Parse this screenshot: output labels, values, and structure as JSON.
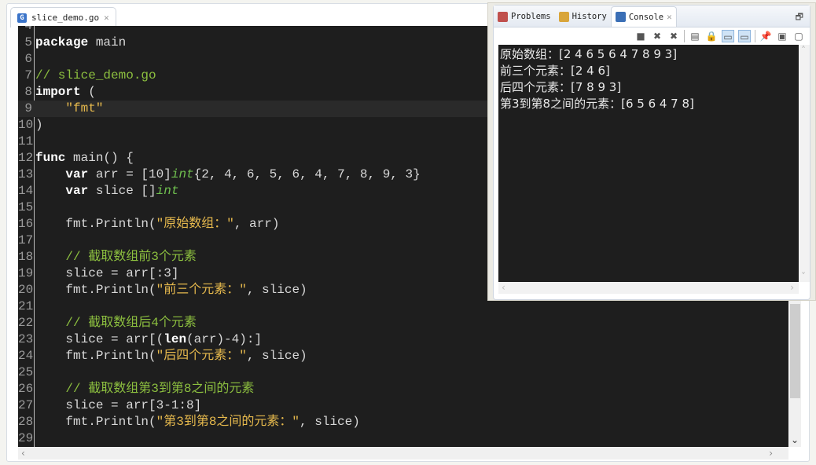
{
  "editor": {
    "tab_label": "slice_demo.go",
    "highlight_line": 9,
    "first_line": 4,
    "lines": [
      {
        "n": "4",
        "tokens": []
      },
      {
        "n": "5",
        "tokens": [
          {
            "t": "package",
            "c": "kw"
          },
          {
            "t": " main",
            "c": ""
          }
        ]
      },
      {
        "n": "6",
        "tokens": []
      },
      {
        "n": "7",
        "tokens": [
          {
            "t": "// slice_demo.go",
            "c": "cm"
          }
        ]
      },
      {
        "n": "8",
        "tokens": [
          {
            "t": "import",
            "c": "kw"
          },
          {
            "t": " (",
            "c": ""
          }
        ]
      },
      {
        "n": "9",
        "tokens": [
          {
            "t": "    ",
            "c": ""
          },
          {
            "t": "\"fmt\"",
            "c": "st"
          }
        ]
      },
      {
        "n": "10",
        "tokens": [
          {
            "t": ")",
            "c": ""
          }
        ]
      },
      {
        "n": "11",
        "tokens": []
      },
      {
        "n": "12",
        "tokens": [
          {
            "t": "func",
            "c": "kw"
          },
          {
            "t": " main() {",
            "c": ""
          }
        ]
      },
      {
        "n": "13",
        "tokens": [
          {
            "t": "    ",
            "c": ""
          },
          {
            "t": "var",
            "c": "kw"
          },
          {
            "t": " arr = [10]",
            "c": ""
          },
          {
            "t": "int",
            "c": "ty"
          },
          {
            "t": "{2, 4, 6, 5, 6, 4, 7, 8, 9, 3}",
            "c": ""
          }
        ]
      },
      {
        "n": "14",
        "tokens": [
          {
            "t": "    ",
            "c": ""
          },
          {
            "t": "var",
            "c": "kw"
          },
          {
            "t": " slice []",
            "c": ""
          },
          {
            "t": "int",
            "c": "ty"
          }
        ]
      },
      {
        "n": "15",
        "tokens": []
      },
      {
        "n": "16",
        "tokens": [
          {
            "t": "    fmt.Println(",
            "c": ""
          },
          {
            "t": "\"原始数组：\"",
            "c": "st"
          },
          {
            "t": ", arr)",
            "c": ""
          }
        ]
      },
      {
        "n": "17",
        "tokens": []
      },
      {
        "n": "18",
        "tokens": [
          {
            "t": "    ",
            "c": ""
          },
          {
            "t": "// 截取数组前3个元素",
            "c": "cm"
          }
        ]
      },
      {
        "n": "19",
        "tokens": [
          {
            "t": "    slice = arr[:3]",
            "c": ""
          }
        ]
      },
      {
        "n": "20",
        "tokens": [
          {
            "t": "    fmt.Println(",
            "c": ""
          },
          {
            "t": "\"前三个元素：\"",
            "c": "st"
          },
          {
            "t": ", slice)",
            "c": ""
          }
        ]
      },
      {
        "n": "21",
        "tokens": []
      },
      {
        "n": "22",
        "tokens": [
          {
            "t": "    ",
            "c": ""
          },
          {
            "t": "// 截取数组后4个元素",
            "c": "cm"
          }
        ]
      },
      {
        "n": "23",
        "tokens": [
          {
            "t": "    slice = arr[(",
            "c": ""
          },
          {
            "t": "len",
            "c": "kw"
          },
          {
            "t": "(arr)-4):]",
            "c": ""
          }
        ]
      },
      {
        "n": "24",
        "tokens": [
          {
            "t": "    fmt.Println(",
            "c": ""
          },
          {
            "t": "\"后四个元素：\"",
            "c": "st"
          },
          {
            "t": ", slice)",
            "c": ""
          }
        ]
      },
      {
        "n": "25",
        "tokens": []
      },
      {
        "n": "26",
        "tokens": [
          {
            "t": "    ",
            "c": ""
          },
          {
            "t": "// 截取数组第3到第8之间的元素",
            "c": "cm"
          }
        ]
      },
      {
        "n": "27",
        "tokens": [
          {
            "t": "    slice = arr[3-1:8]",
            "c": ""
          }
        ]
      },
      {
        "n": "28",
        "tokens": [
          {
            "t": "    fmt.Println(",
            "c": ""
          },
          {
            "t": "\"第3到第8之间的元素：\"",
            "c": "st"
          },
          {
            "t": ", slice)",
            "c": ""
          }
        ]
      },
      {
        "n": "29",
        "tokens": []
      }
    ]
  },
  "panel": {
    "tabs": [
      {
        "label": "Problems",
        "icon": "problems-icon",
        "color": "#c0504d"
      },
      {
        "label": "History",
        "icon": "history-icon",
        "color": "#d9a53a"
      },
      {
        "label": "Console",
        "icon": "console-icon",
        "color": "#3b6fb6",
        "active": true
      }
    ],
    "toolbar": [
      {
        "icon": "terminate-icon",
        "glyph": "■"
      },
      {
        "icon": "remove-launch-icon",
        "glyph": "✖"
      },
      {
        "icon": "remove-all-icon",
        "glyph": "✖"
      },
      {
        "icon": "clear-console-icon",
        "glyph": "▤"
      },
      {
        "icon": "scroll-lock-icon",
        "glyph": "🔒"
      },
      {
        "icon": "show-on-stdout-icon",
        "glyph": "▭",
        "on": true
      },
      {
        "icon": "show-on-stderr-icon",
        "glyph": "▭",
        "on": true
      },
      {
        "icon": "pin-console-icon",
        "glyph": "📌"
      },
      {
        "icon": "display-console-icon",
        "glyph": "▣"
      },
      {
        "icon": "open-console-icon",
        "glyph": "▢"
      }
    ],
    "console_lines": [
      "原始数组：[2 4 6 5 6 4 7 8 9 3]",
      "前三个元素：[2 4 6]",
      "后四个元素：[7 8 9 3]",
      "第3到第8之间的元素：[6 5 6 4 7 8]"
    ]
  }
}
